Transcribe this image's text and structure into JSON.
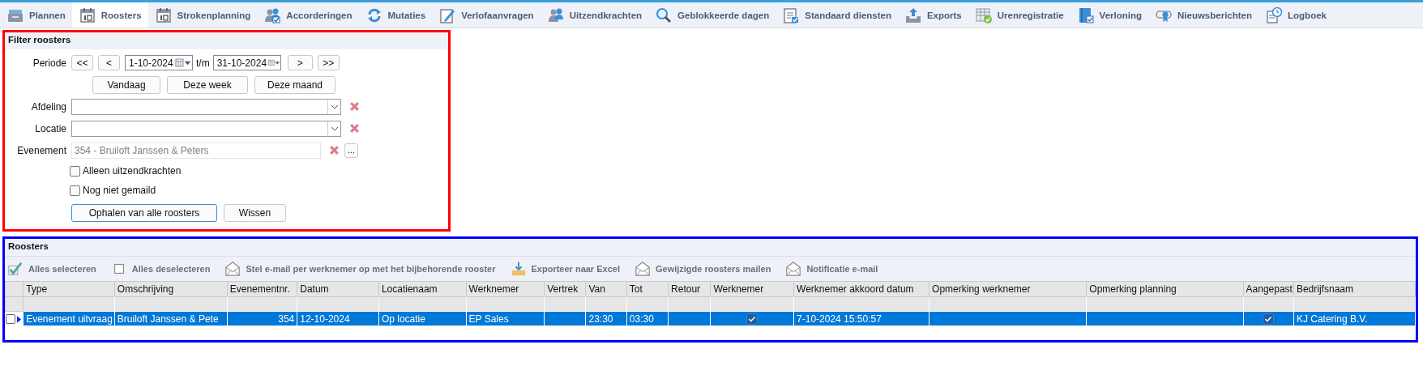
{
  "menu": [
    {
      "label": "Plannen",
      "selected": false
    },
    {
      "label": "Roosters",
      "selected": true
    },
    {
      "label": "Strokenplanning",
      "selected": false
    },
    {
      "label": "Accorderingen",
      "selected": false
    },
    {
      "label": "Mutaties",
      "selected": false
    },
    {
      "label": "Verlofaanvragen",
      "selected": false
    },
    {
      "label": "Uitzendkrachten",
      "selected": false
    },
    {
      "label": "Geblokkeerde dagen",
      "selected": false
    },
    {
      "label": "Standaard diensten",
      "selected": false
    },
    {
      "label": "Exports",
      "selected": false
    },
    {
      "label": "Urenregistratie",
      "selected": false
    },
    {
      "label": "Verloning",
      "selected": false
    },
    {
      "label": "Nieuwsberichten",
      "selected": false
    },
    {
      "label": "Logboek",
      "selected": false
    }
  ],
  "filter": {
    "title": "Filter roosters",
    "periode_label": "Periode",
    "first": "<<",
    "prev": "<",
    "from": "1-10-2024",
    "to_label": "t/m",
    "to": "31-10-2024",
    "next": ">",
    "last": ">>",
    "quick": [
      "Vandaag",
      "Deze week",
      "Deze maand"
    ],
    "afdeling_label": "Afdeling",
    "locatie_label": "Locatie",
    "evenement_label": "Evenement",
    "evenement": {
      "value": "354 - Bruiloft Janssen & Peters",
      "disabled": true
    },
    "browse": "...",
    "options": [
      {
        "label": "Alleen uitzendkrachten",
        "checked": false
      },
      {
        "label": "Nog niet gemaild",
        "checked": false
      }
    ],
    "fetch": "Ophalen van alle roosters",
    "clear": "Wissen"
  },
  "roosters": {
    "title": "Roosters",
    "actions": [
      "Alles selecteren",
      "Alles deselecteren",
      "Stel e-mail per werknemer op met het bijbehorende rooster",
      "Exporteer naar Excel",
      "Gewijzigde roosters mailen",
      "Notificatie e-mail"
    ],
    "columns": [
      "Type",
      "Omschrijving",
      "Evenementnr.",
      "Datum",
      "Locatienaam",
      "Werknemer",
      "Vertrek",
      "Van",
      "Tot",
      "Retour",
      "Werknemer",
      "Werknemer akkoord datum",
      "Opmerking werknemer",
      "Opmerking planning",
      "Aangepast",
      "Bedrijfsnaam"
    ],
    "rows": [
      {
        "selected": true,
        "checked": false,
        "type": "Evenement uitvraag",
        "omschrijving": "Bruiloft Janssen & Pete",
        "evenementnr": "354",
        "datum": "12-10-2024",
        "locatienaam": "Op locatie",
        "werknemer": "EP Sales",
        "van": "23:30",
        "tot": "03:30",
        "werknemer_akkoord": true,
        "akkoord_datum": "7-10-2024 15:50:57",
        "aangepast": true,
        "bedrijfsnaam": "KJ Catering B.V."
      }
    ]
  }
}
